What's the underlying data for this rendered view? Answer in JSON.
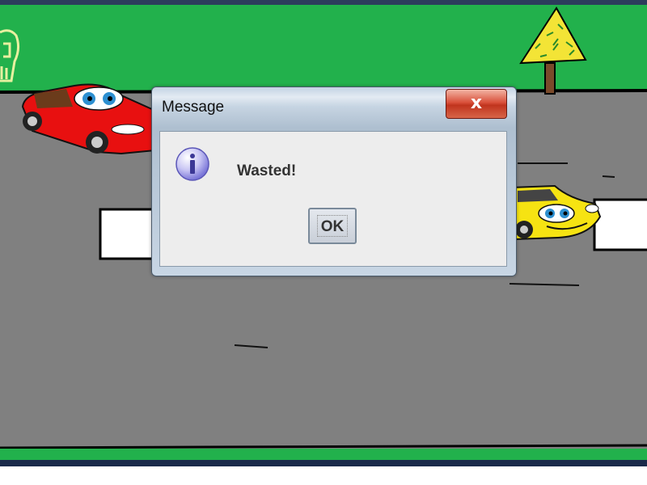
{
  "dialog": {
    "title": "Message",
    "close_glyph": "x",
    "message": "Wasted!",
    "ok_label": "OK",
    "icon": "info-icon"
  },
  "colors": {
    "grass": "#22b14c",
    "road": "#808080",
    "red_car": "#e81010",
    "yellow_car": "#f6e312",
    "tree_leaves": "#f3e436"
  }
}
